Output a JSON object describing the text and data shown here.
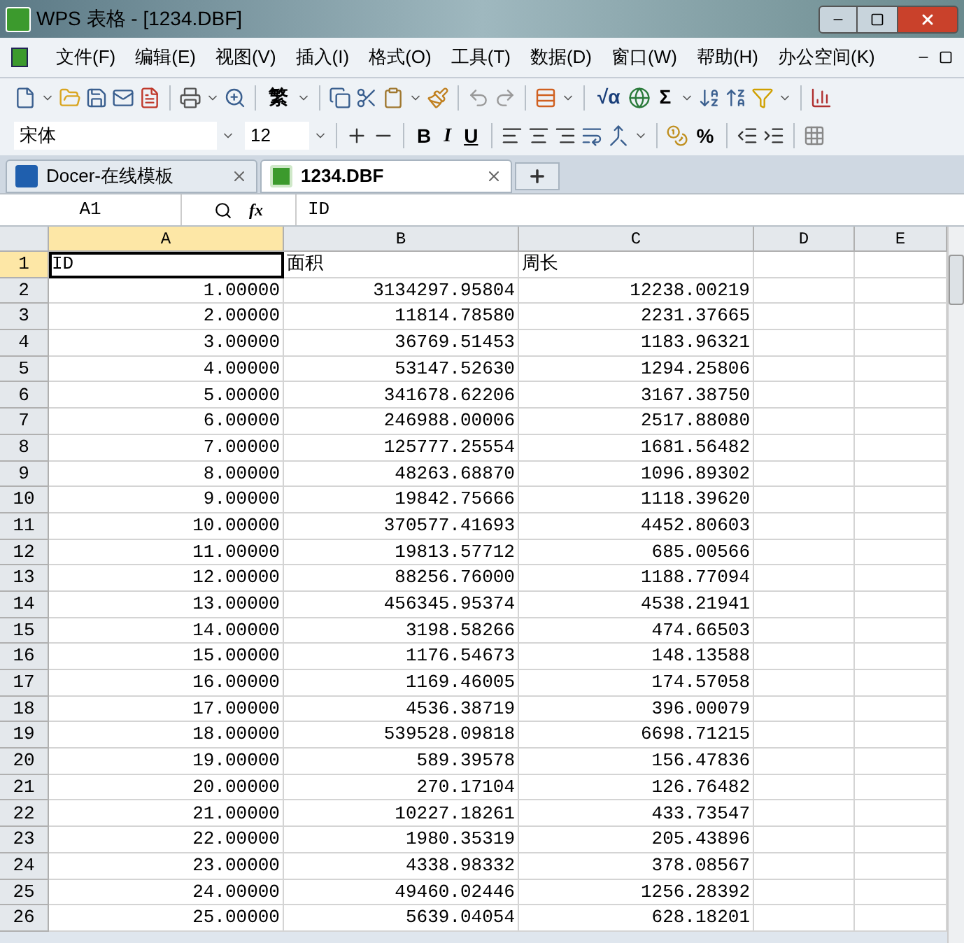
{
  "window": {
    "title": "WPS 表格 - [1234.DBF]"
  },
  "menu": [
    "文件(F)",
    "编辑(E)",
    "视图(V)",
    "插入(I)",
    "格式(O)",
    "工具(T)",
    "数据(D)",
    "窗口(W)",
    "帮助(H)",
    "办公空间(K)"
  ],
  "toolbar": {
    "texts": [
      "繁",
      "√α",
      "Σ"
    ]
  },
  "format_bar": {
    "font": "宋体",
    "size": "12",
    "texts": [
      "B",
      "I",
      "U",
      "%"
    ]
  },
  "tabs": [
    {
      "label": "Docer-在线模板",
      "selected": false
    },
    {
      "label": "1234.DBF",
      "selected": true
    }
  ],
  "formula_bar": {
    "cell_ref": "A1",
    "fx": "fx",
    "value": "ID"
  },
  "columns": [
    {
      "label": "A",
      "selected": true
    },
    {
      "label": "B",
      "selected": false
    },
    {
      "label": "C",
      "selected": false
    },
    {
      "label": "D",
      "selected": false
    },
    {
      "label": "E",
      "selected": false
    }
  ],
  "rows": [
    {
      "number": "1",
      "selected": true,
      "cells": [
        "ID",
        "面积",
        "周长"
      ]
    },
    {
      "number": "2",
      "selected": false,
      "cells": [
        "1.00000",
        "3134297.95804",
        "12238.00219"
      ]
    },
    {
      "number": "3",
      "selected": false,
      "cells": [
        "2.00000",
        "11814.78580",
        "2231.37665"
      ]
    },
    {
      "number": "4",
      "selected": false,
      "cells": [
        "3.00000",
        "36769.51453",
        "1183.96321"
      ]
    },
    {
      "number": "5",
      "selected": false,
      "cells": [
        "4.00000",
        "53147.52630",
        "1294.25806"
      ]
    },
    {
      "number": "6",
      "selected": false,
      "cells": [
        "5.00000",
        "341678.62206",
        "3167.38750"
      ]
    },
    {
      "number": "7",
      "selected": false,
      "cells": [
        "6.00000",
        "246988.00006",
        "2517.88080"
      ]
    },
    {
      "number": "8",
      "selected": false,
      "cells": [
        "7.00000",
        "125777.25554",
        "1681.56482"
      ]
    },
    {
      "number": "9",
      "selected": false,
      "cells": [
        "8.00000",
        "48263.68870",
        "1096.89302"
      ]
    },
    {
      "number": "10",
      "selected": false,
      "cells": [
        "9.00000",
        "19842.75666",
        "1118.39620"
      ]
    },
    {
      "number": "11",
      "selected": false,
      "cells": [
        "10.00000",
        "370577.41693",
        "4452.80603"
      ]
    },
    {
      "number": "12",
      "selected": false,
      "cells": [
        "11.00000",
        "19813.57712",
        "685.00566"
      ]
    },
    {
      "number": "13",
      "selected": false,
      "cells": [
        "12.00000",
        "88256.76000",
        "1188.77094"
      ]
    },
    {
      "number": "14",
      "selected": false,
      "cells": [
        "13.00000",
        "456345.95374",
        "4538.21941"
      ]
    },
    {
      "number": "15",
      "selected": false,
      "cells": [
        "14.00000",
        "3198.58266",
        "474.66503"
      ]
    },
    {
      "number": "16",
      "selected": false,
      "cells": [
        "15.00000",
        "1176.54673",
        "148.13588"
      ]
    },
    {
      "number": "17",
      "selected": false,
      "cells": [
        "16.00000",
        "1169.46005",
        "174.57058"
      ]
    },
    {
      "number": "18",
      "selected": false,
      "cells": [
        "17.00000",
        "4536.38719",
        "396.00079"
      ]
    },
    {
      "number": "19",
      "selected": false,
      "cells": [
        "18.00000",
        "539528.09818",
        "6698.71215"
      ]
    },
    {
      "number": "20",
      "selected": false,
      "cells": [
        "19.00000",
        "589.39578",
        "156.47836"
      ]
    },
    {
      "number": "21",
      "selected": false,
      "cells": [
        "20.00000",
        "270.17104",
        "126.76482"
      ]
    },
    {
      "number": "22",
      "selected": false,
      "cells": [
        "21.00000",
        "10227.18261",
        "433.73547"
      ]
    },
    {
      "number": "23",
      "selected": false,
      "cells": [
        "22.00000",
        "1980.35319",
        "205.43896"
      ]
    },
    {
      "number": "24",
      "selected": false,
      "cells": [
        "23.00000",
        "4338.98332",
        "378.08567"
      ]
    },
    {
      "number": "25",
      "selected": false,
      "cells": [
        "24.00000",
        "49460.02446",
        "1256.28392"
      ]
    },
    {
      "number": "26",
      "selected": false,
      "cells": [
        "25.00000",
        "5639.04054",
        "628.18201"
      ]
    }
  ]
}
